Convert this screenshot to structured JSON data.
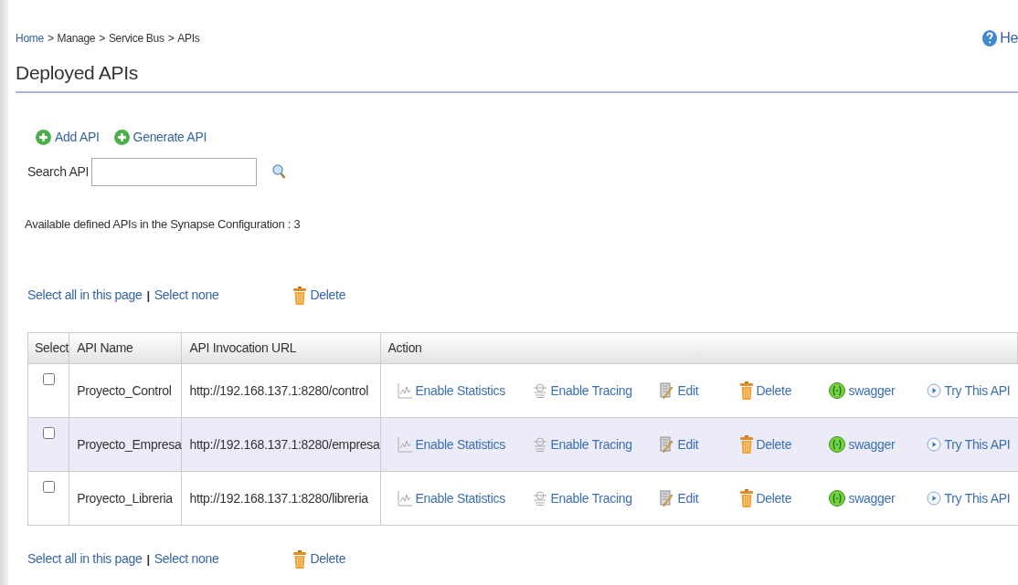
{
  "breadcrumb": [
    {
      "label": "Home",
      "link": true
    },
    {
      "label": "Manage",
      "link": false
    },
    {
      "label": "Service Bus",
      "link": false
    },
    {
      "label": "APIs",
      "link": false
    }
  ],
  "breadcrumb_separator": ">",
  "help": {
    "label": "He"
  },
  "title": "Deployed APIs",
  "toolbar": [
    {
      "label": "Add API"
    },
    {
      "label": "Generate API"
    }
  ],
  "search": {
    "label": "Search API"
  },
  "summary": "Available defined APIs in the Synapse Configuration : 3",
  "selection_top": {
    "select_all": "Select all in this page",
    "separator": "|",
    "select_none": "Select none",
    "delete": "Delete"
  },
  "table": {
    "columns": [
      "Select",
      "API Name",
      "API Invocation URL",
      "Action"
    ],
    "rows": [
      {
        "checked": false,
        "highlighted": false,
        "name": "Proyecto_Control",
        "url": "http://192.168.137.1:8280/control",
        "actions": [
          {
            "kind": "statistics",
            "label": "Enable Statistics"
          },
          {
            "kind": "tracing",
            "label": "Enable Tracing"
          },
          {
            "kind": "edit",
            "label": "Edit"
          },
          {
            "kind": "delete",
            "label": "Delete"
          },
          {
            "kind": "swagger",
            "label": "swagger"
          },
          {
            "kind": "try",
            "label": "Try This API"
          }
        ]
      },
      {
        "checked": false,
        "highlighted": true,
        "name": "Proyecto_Empresa",
        "url": "http://192.168.137.1:8280/empresa",
        "actions": [
          {
            "kind": "statistics",
            "label": "Enable Statistics"
          },
          {
            "kind": "tracing",
            "label": "Enable Tracing"
          },
          {
            "kind": "edit",
            "label": "Edit"
          },
          {
            "kind": "delete",
            "label": "Delete"
          },
          {
            "kind": "swagger",
            "label": "swagger"
          },
          {
            "kind": "try",
            "label": "Try This API"
          }
        ]
      },
      {
        "checked": false,
        "highlighted": false,
        "name": "Proyecto_Libreria",
        "url": "http://192.168.137.1:8280/libreria",
        "actions": [
          {
            "kind": "statistics",
            "label": "Enable Statistics"
          },
          {
            "kind": "tracing",
            "label": "Enable Tracing"
          },
          {
            "kind": "edit",
            "label": "Edit"
          },
          {
            "kind": "delete",
            "label": "Delete"
          },
          {
            "kind": "swagger",
            "label": "swagger"
          },
          {
            "kind": "try",
            "label": "Try This API"
          }
        ]
      }
    ]
  },
  "selection_bottom": {
    "select_all": "Select all in this page",
    "separator": "|",
    "select_none": "Select none",
    "delete": "Delete"
  }
}
